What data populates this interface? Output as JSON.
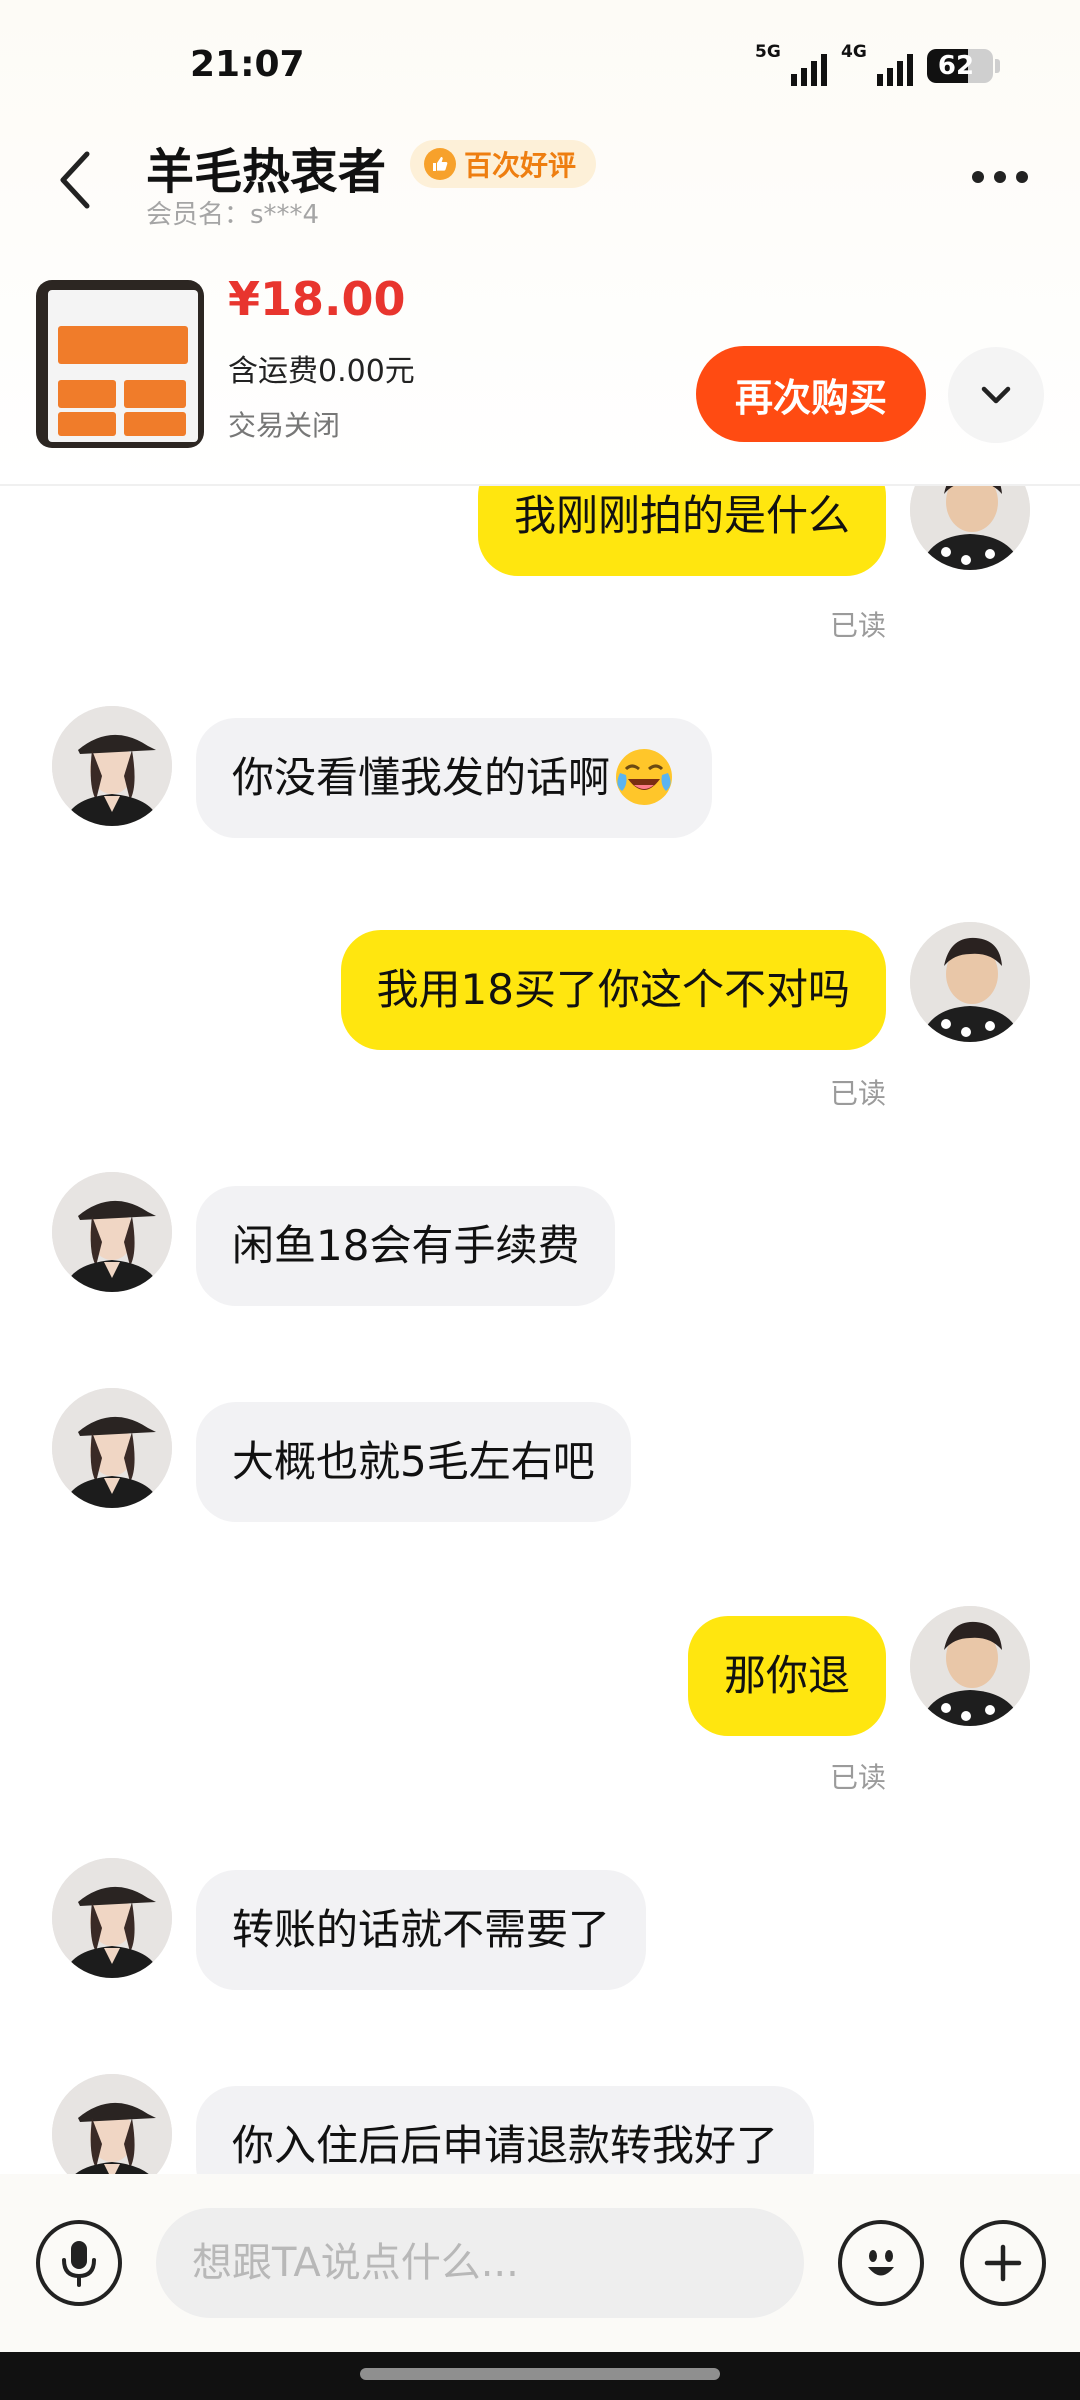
{
  "status_bar": {
    "time": "21:07",
    "signal_1_label": "5G",
    "signal_2_label": "4G",
    "battery_percent": "62",
    "battery_level": 0.62
  },
  "header": {
    "nickname": "羊毛热衷者",
    "badge": "百次好评",
    "member": "会员名：s***4"
  },
  "product": {
    "price": "¥18.00",
    "shipping": "含运费0.00元",
    "status": "交易关闭",
    "buy_again": "再次购买"
  },
  "messages": [
    {
      "side": "out",
      "text": "我刚刚拍的是什么",
      "read": "已读"
    },
    {
      "side": "in",
      "text": "你没看懂我发的话啊",
      "emoji": "crying-laughing-emoji"
    },
    {
      "side": "out",
      "text": "我用18买了你这个不对吗",
      "read": "已读"
    },
    {
      "side": "in",
      "text": "闲鱼18会有手续费"
    },
    {
      "side": "in",
      "text": "大概也就5毛左右吧"
    },
    {
      "side": "out",
      "text": "那你退",
      "read": "已读"
    },
    {
      "side": "in",
      "text": "转账的话就不需要了"
    },
    {
      "side": "in",
      "text": "你入住后后申请退款转我好了"
    }
  ],
  "input": {
    "placeholder": "想跟TA说点什么..."
  },
  "colors": {
    "outgoing_bubble": "#ffe60f",
    "incoming_bubble": "#f2f2f4",
    "buy_again_button": "#ff4b12",
    "price": "#e8352e",
    "badge_text": "#ee7e10"
  }
}
